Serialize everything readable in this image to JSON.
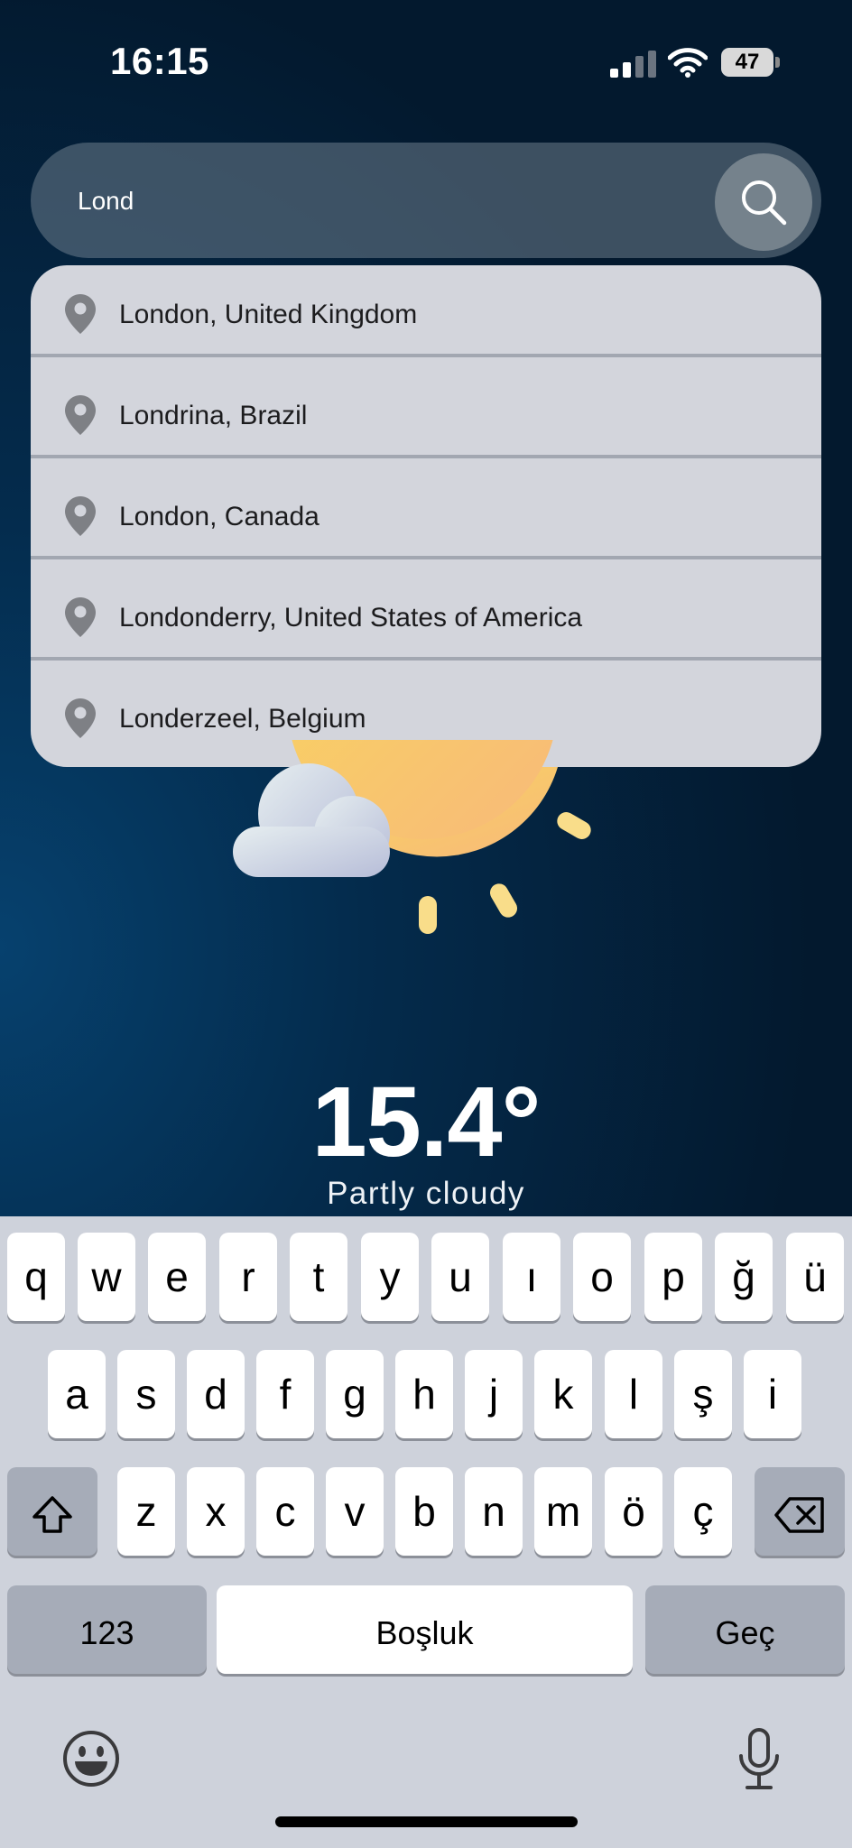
{
  "status_bar": {
    "time": "16:15",
    "battery": "47"
  },
  "search": {
    "value": "Lond",
    "icon": "search-icon"
  },
  "suggestions": [
    {
      "label": "London, United Kingdom",
      "icon": "location-pin-icon"
    },
    {
      "label": "Londrina, Brazil",
      "icon": "location-pin-icon"
    },
    {
      "label": "London, Canada",
      "icon": "location-pin-icon"
    },
    {
      "label": "Londonderry, United States of America",
      "icon": "location-pin-icon"
    },
    {
      "label": "Londerzeel, Belgium",
      "icon": "location-pin-icon"
    }
  ],
  "weather": {
    "temperature": "15.4°",
    "condition": "Partly cloudy",
    "icon": "partly-cloudy-icon"
  },
  "keyboard": {
    "row1": [
      "q",
      "w",
      "e",
      "r",
      "t",
      "y",
      "u",
      "ı",
      "o",
      "p",
      "ğ",
      "ü"
    ],
    "row2": [
      "a",
      "s",
      "d",
      "f",
      "g",
      "h",
      "j",
      "k",
      "l",
      "ş",
      "i"
    ],
    "row3": [
      "z",
      "x",
      "c",
      "v",
      "b",
      "n",
      "m",
      "ö",
      "ç"
    ],
    "numbers_label": "123",
    "space_label": "Boşluk",
    "return_label": "Geç"
  },
  "colors": {
    "background": "#042b4c",
    "dropdown": "#d3d5dc",
    "keyboard": "#ced2db",
    "sun": "#f8c65b",
    "sun_rays": "#f9dd8a"
  }
}
